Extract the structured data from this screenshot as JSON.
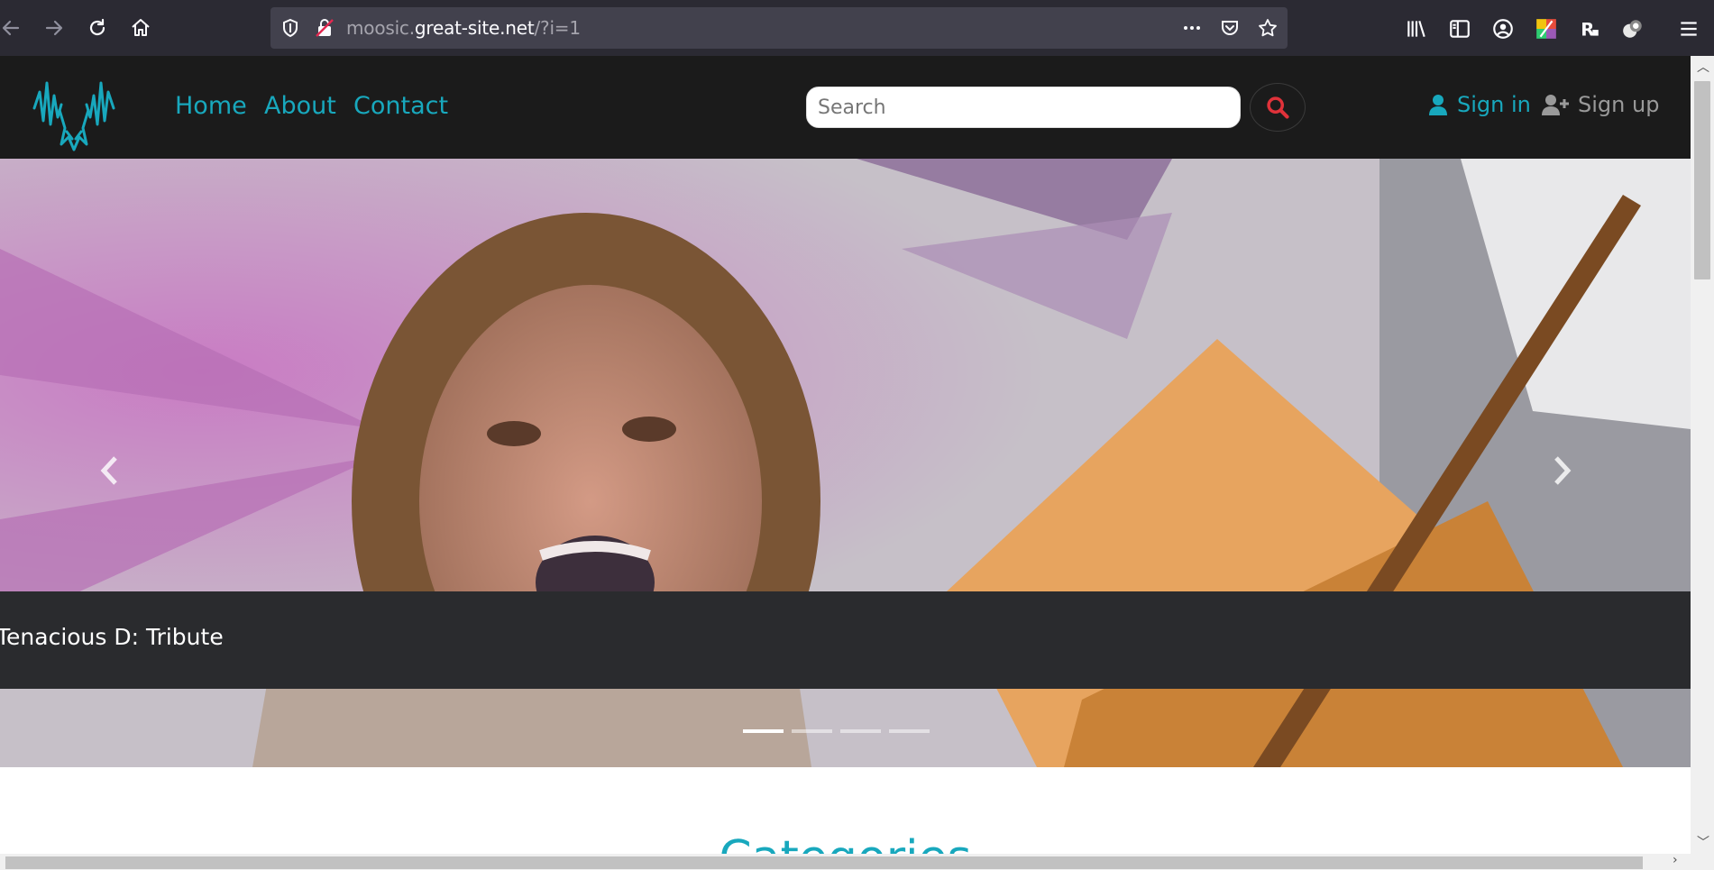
{
  "browser": {
    "url_prefix": "moosic.",
    "url_domain": "great-site.net",
    "url_path": "/?i=1",
    "icons": [
      "back-icon",
      "forward-icon",
      "reload-icon",
      "home-icon",
      "shield-icon",
      "insecure-lock-icon",
      "more-icon",
      "pocket-icon",
      "star-icon",
      "library-icon",
      "sidebar-icon",
      "account-icon",
      "extension-icon",
      "extension-icon",
      "extension-icon",
      "menu-icon"
    ]
  },
  "site": {
    "nav": {
      "links": [
        "Home",
        "About",
        "Contact"
      ],
      "search_placeholder": "Search",
      "sign_in": "Sign in",
      "sign_up": "Sign up"
    },
    "carousel": {
      "caption": "Tenacious D: Tribute",
      "slide_count": 4,
      "active_slide": 1
    },
    "section_title": "Categories"
  },
  "colors": {
    "accent": "#18a8bd",
    "search_icon": "#e0323a",
    "navbar_bg": "#1b1b1b",
    "sign_up": "#9a9a9a"
  }
}
